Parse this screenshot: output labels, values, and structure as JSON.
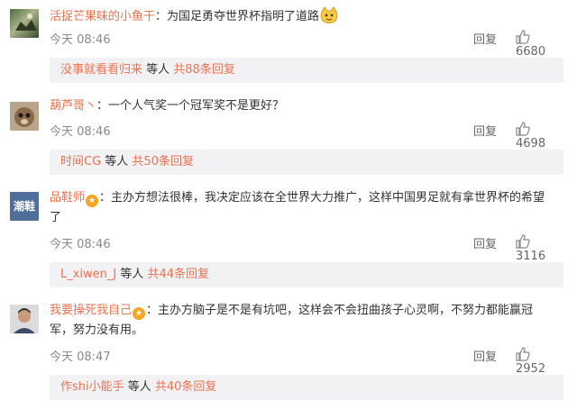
{
  "comments": [
    {
      "username": "活捉芒果味的小鱼干",
      "content": "：为国足勇夺世界杯指明了道路",
      "emoji": "cat-emoji",
      "time": "今天 08:46",
      "reply_label": "回复",
      "likes": "6680",
      "replies": {
        "user": "没事就看看归来",
        "mid": " 等人 ",
        "count": "共88条回复"
      }
    },
    {
      "username": "葫芦哥丶",
      "content": "：一个人气奖一个冠军奖不是更好？",
      "time": "今天 08:46",
      "reply_label": "回复",
      "likes": "4698",
      "replies": {
        "user": "时间CG",
        "mid": " 等人 ",
        "count": "共50条回复"
      }
    },
    {
      "username": "品鞋师",
      "content_line1": "：主办方想法很棒，我决定应该在全世界大力推广，这样中国男足就有拿世界杯的希望",
      "content_line2": "了",
      "time": "今天 08:46",
      "reply_label": "回复",
      "likes": "3116",
      "avatar_text": "潮鞋",
      "replies": {
        "user": "L_xiwen_J",
        "mid": " 等人 ",
        "count": "共44条回复"
      }
    },
    {
      "username": "我要操死我自己",
      "content_line1": "：主办方脑子是不是有坑吧，这样会不会扭曲孩子心灵啊，不努力都能赢冠",
      "content_line2": "军，努力没有用。",
      "time": "今天 08:47",
      "reply_label": "回复",
      "likes": "2952",
      "replies": {
        "user": "作shi小能手",
        "mid": " 等人 ",
        "count": "共40条回复"
      }
    }
  ],
  "colors": {
    "accent": "#eb7350",
    "muted": "#8a8a8a",
    "reply_bg": "#f2f2f5"
  }
}
